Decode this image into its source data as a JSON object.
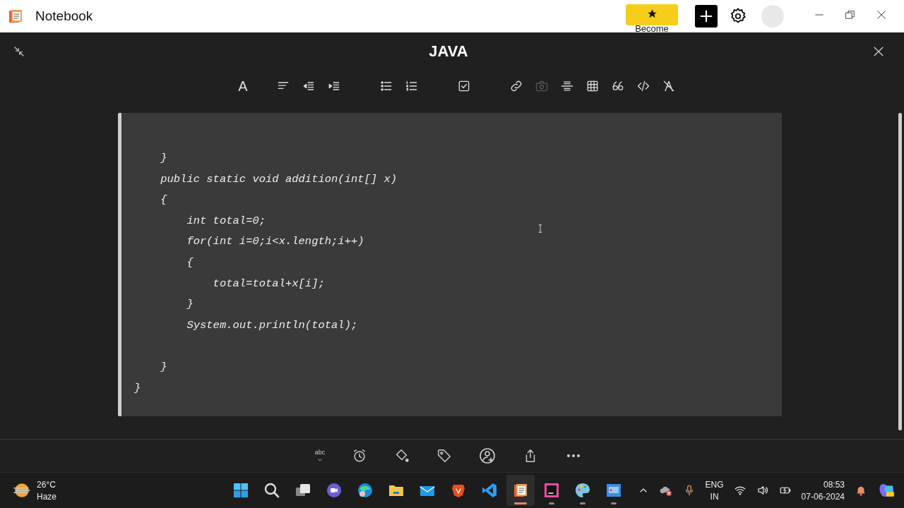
{
  "window": {
    "title": "Notebook",
    "promo_button": "Become"
  },
  "note": {
    "title": "JAVA",
    "font_label": "A",
    "tools": [
      {
        "disabled": false
      },
      {
        "disabled": false
      },
      {
        "disabled": false
      },
      {
        "disabled": false
      },
      {
        "disabled": false
      },
      {
        "disabled": false
      },
      {
        "disabled": false
      },
      {
        "disabled": true
      },
      {
        "disabled": false
      },
      {
        "disabled": false
      },
      {
        "disabled": false
      },
      {
        "disabled": false
      },
      {
        "disabled": false
      }
    ],
    "code_lines": [
      {
        "text": "    }",
        "space_before": false
      },
      {
        "text": "    public static void addition(int[] x)",
        "space_before": false
      },
      {
        "text": "    {",
        "space_before": false
      },
      {
        "text": "        int total=0;",
        "space_before": false
      },
      {
        "text": "        for(int i=0;i<x.length;i++)",
        "space_before": false
      },
      {
        "text": "        {",
        "space_before": false
      },
      {
        "text": "            total=total+x[i];",
        "space_before": false
      },
      {
        "text": "        }",
        "space_before": false
      },
      {
        "text": "        System.out.println(total);",
        "space_before": false
      },
      {
        "text": "    }",
        "space_before": true
      },
      {
        "text": "}",
        "space_before": false
      }
    ],
    "spellcheck_label": "abc"
  },
  "taskbar": {
    "temperature": "26°C",
    "weather": "Haze",
    "apps": [
      {
        "running": false,
        "selected": false
      },
      {
        "running": false,
        "selected": false
      },
      {
        "running": false,
        "selected": false
      },
      {
        "running": false,
        "selected": false
      },
      {
        "running": false,
        "selected": false
      },
      {
        "running": false,
        "selected": false
      },
      {
        "running": false,
        "selected": false
      },
      {
        "running": false,
        "selected": false
      },
      {
        "running": false,
        "selected": false
      },
      {
        "running": true,
        "selected": true
      },
      {
        "running": true,
        "selected": false
      },
      {
        "running": true,
        "selected": false
      },
      {
        "running": true,
        "selected": false
      }
    ],
    "language": "ENG",
    "region": "IN",
    "time": "08:53",
    "date": "07-06-2024"
  }
}
